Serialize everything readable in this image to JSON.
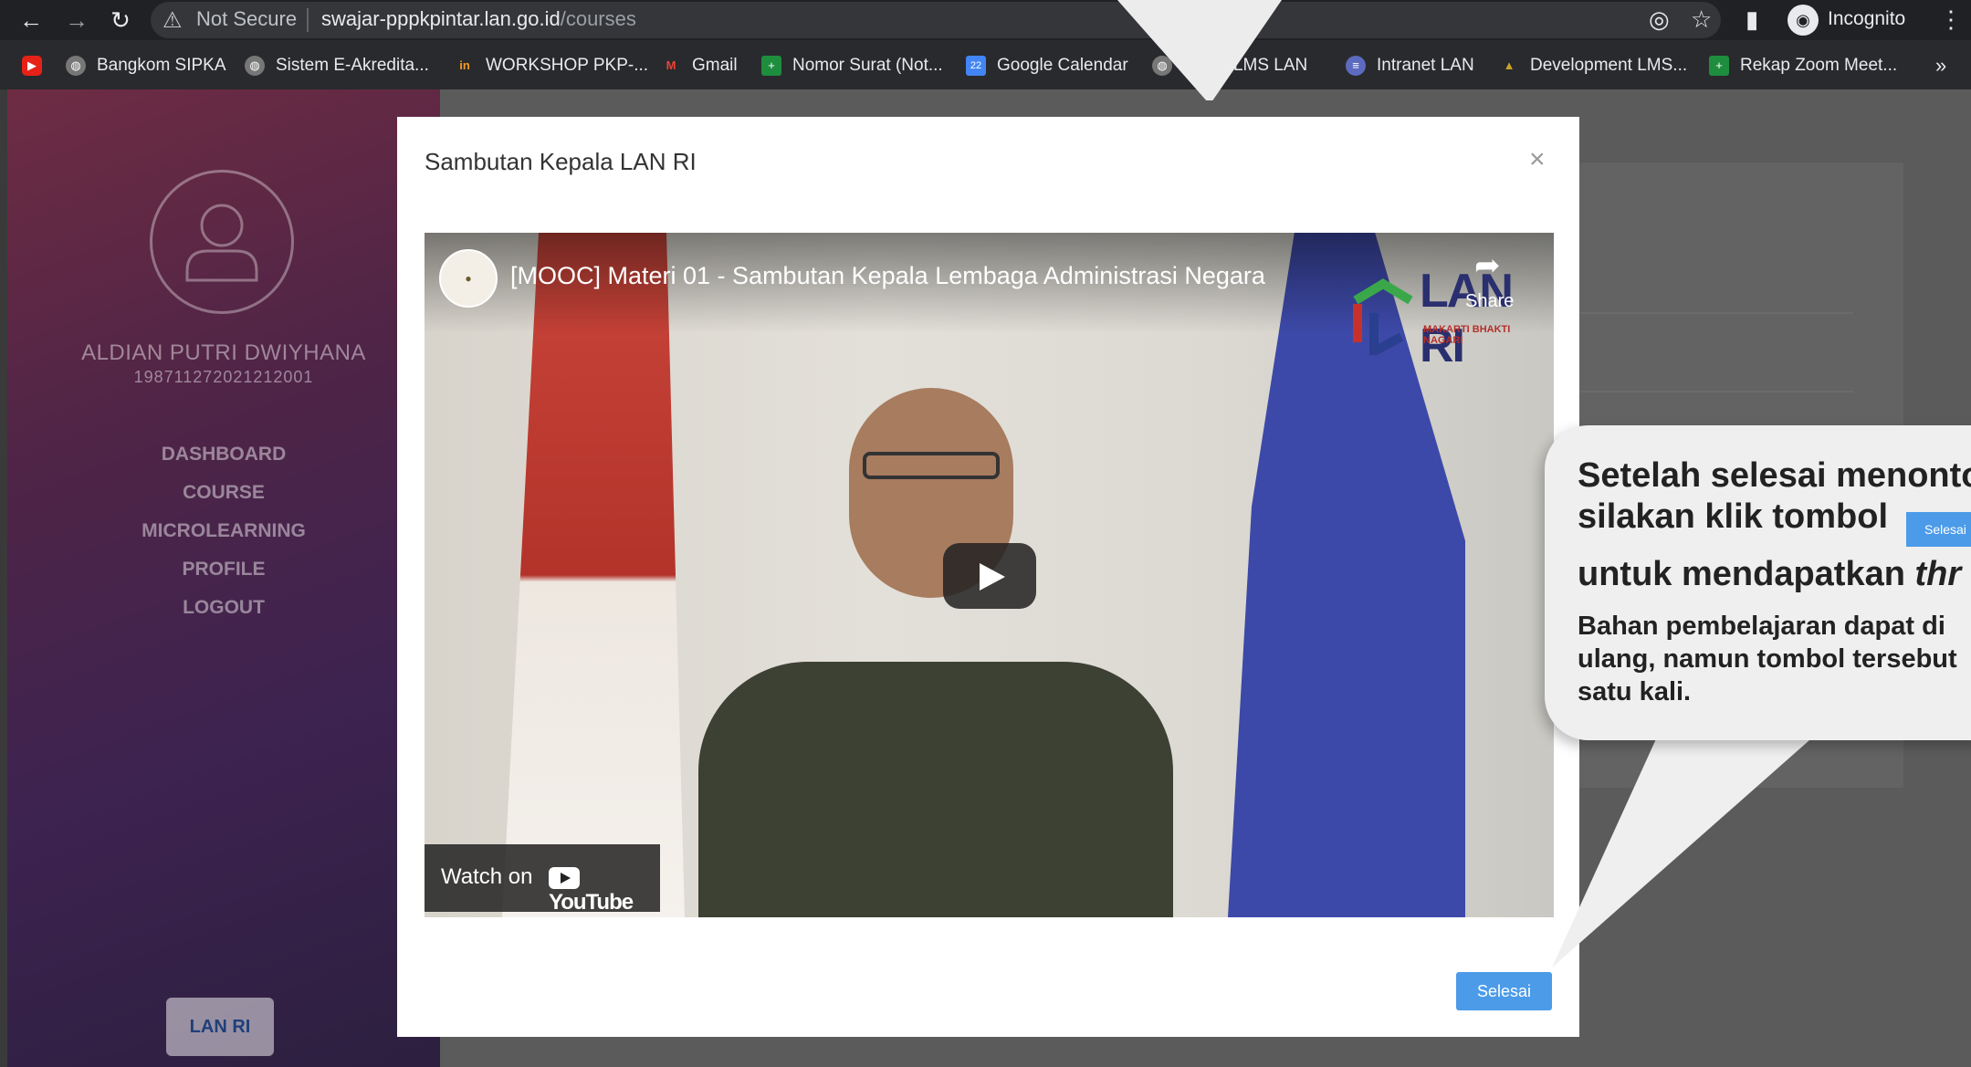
{
  "browser": {
    "security_label": "Not Secure",
    "url_host": "swajar-pppkpintar.lan.go.id",
    "url_path": "/courses",
    "profile_label": "Incognito"
  },
  "bookmarks": [
    {
      "label": "Bangkom SIPKA"
    },
    {
      "label": "Sistem E-Akredita..."
    },
    {
      "label": "WORKSHOP PKP-..."
    },
    {
      "label": "Gmail"
    },
    {
      "label": "Nomor Surat (Not..."
    },
    {
      "label": "Google Calendar"
    },
    {
      "label": "bjar LMS LAN"
    },
    {
      "label": "Intranet LAN"
    },
    {
      "label": "Development LMS..."
    },
    {
      "label": "Rekap Zoom Meet..."
    }
  ],
  "sidebar": {
    "user_name": "ALDIAN PUTRI DWIYHANA",
    "user_nip": "198711272021212001",
    "menu": [
      "DASHBOARD",
      "COURSE",
      "MICROLEARNING",
      "PROFILE",
      "LOGOUT"
    ],
    "logo_text": "LAN RI"
  },
  "modal": {
    "title": "Sambutan Kepala LAN RI",
    "close_glyph": "×",
    "video": {
      "title": "[MOOC] Materi 01 - Sambutan Kepala Lembaga Administrasi Negara",
      "share_label": "Share",
      "logo_text": "LAN RI",
      "logo_tagline": "MAKARTI BHAKTI NAGARI",
      "watch_on": "Watch on",
      "youtube_label": "YouTube"
    },
    "done_button": "Selesai"
  },
  "callout": {
    "line1": "Setelah selesai menonto",
    "line2": "silakan klik tombol",
    "inline_button": "Selesai",
    "line3_prefix": "untuk mendapatkan ",
    "line3_italic": "thr",
    "small_line1": "Bahan pembelajaran dapat di",
    "small_line2": "ulang, namun tombol tersebut",
    "small_line3": "satu kali."
  }
}
